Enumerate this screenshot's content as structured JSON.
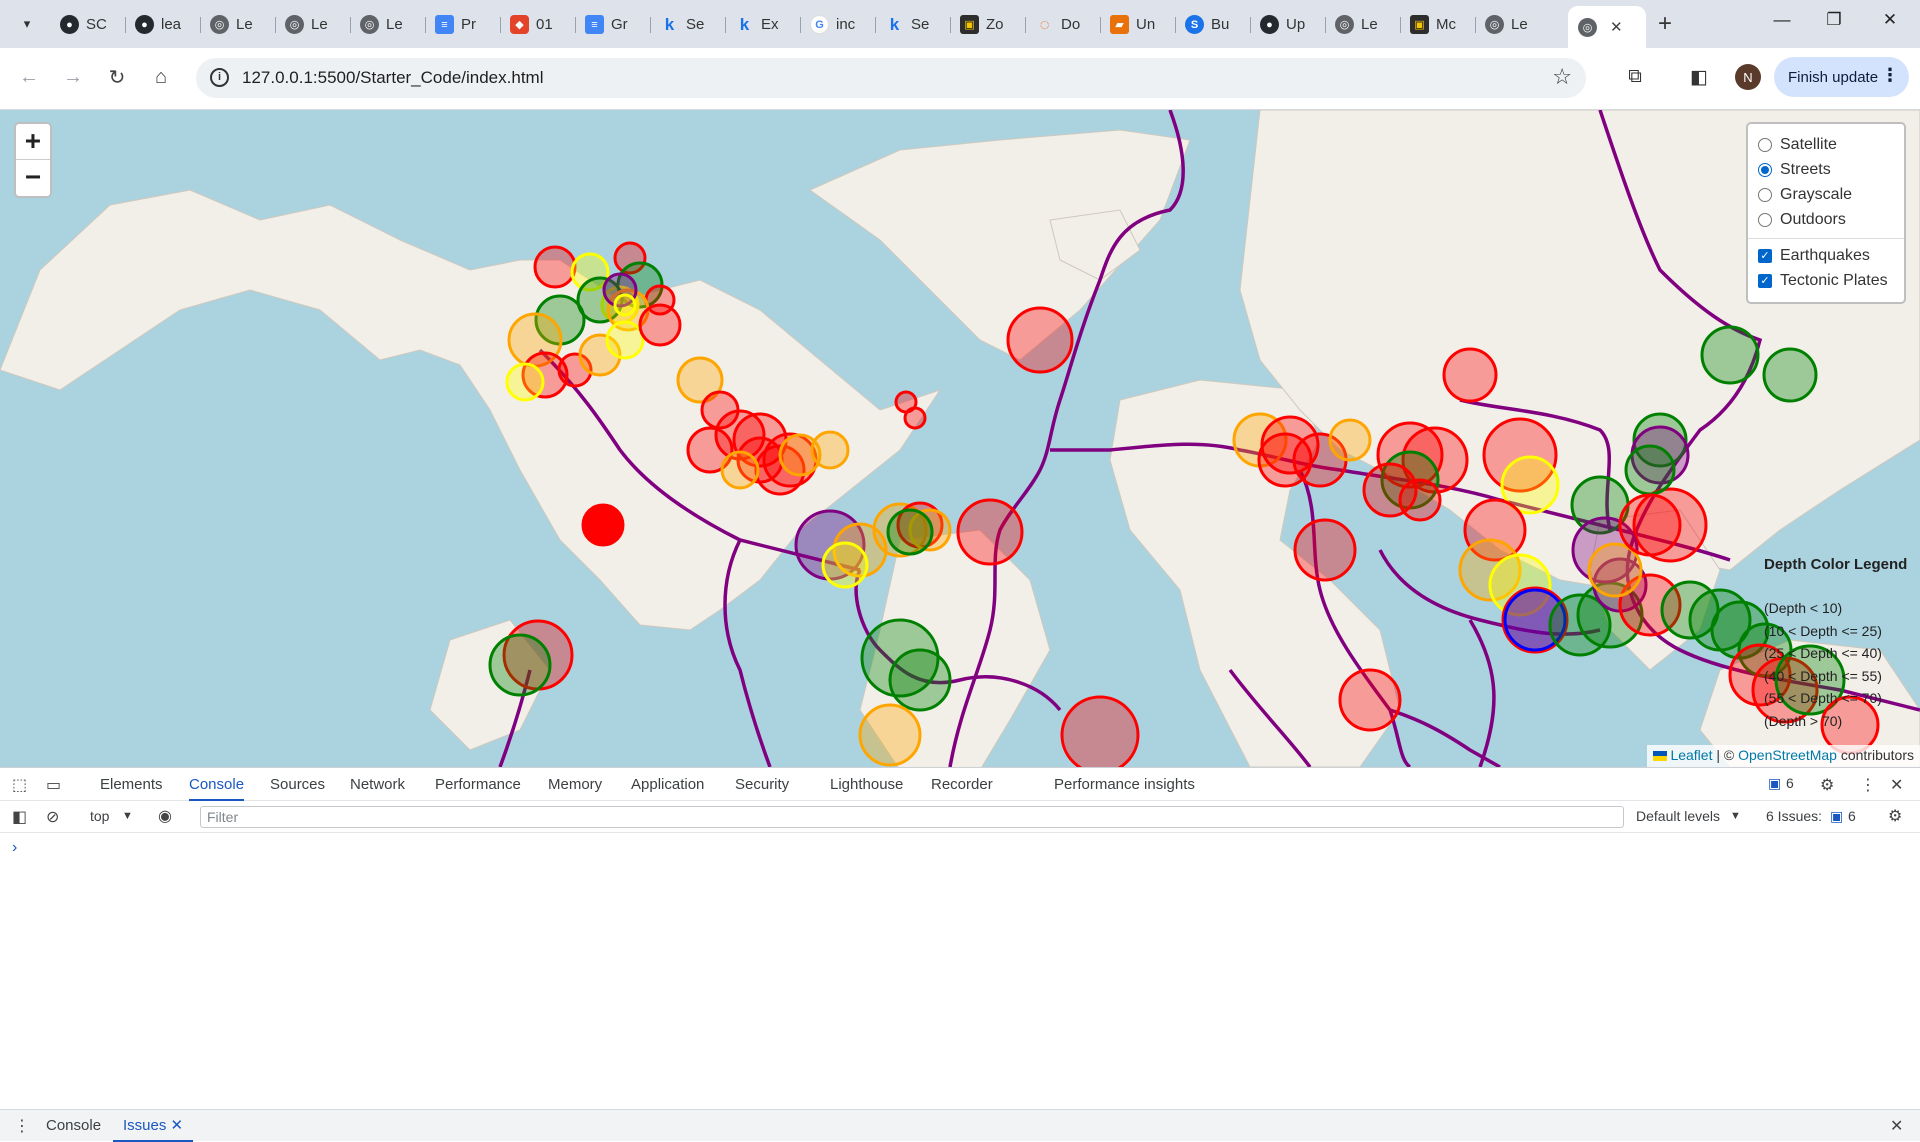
{
  "browser": {
    "tabs": [
      {
        "label": "SC",
        "icon": "github-icon"
      },
      {
        "label": "lea",
        "icon": "github-icon"
      },
      {
        "label": "Le",
        "icon": "globe-icon"
      },
      {
        "label": "Le",
        "icon": "globe-icon"
      },
      {
        "label": "Le",
        "icon": "globe-icon"
      },
      {
        "label": "Pr",
        "icon": "google-docs-icon"
      },
      {
        "label": "01",
        "icon": "gitlab-icon"
      },
      {
        "label": "Gr",
        "icon": "google-docs-icon"
      },
      {
        "label": "Se",
        "icon": "k-icon"
      },
      {
        "label": "Ex",
        "icon": "k-icon"
      },
      {
        "label": "inc",
        "icon": "google-icon"
      },
      {
        "label": "Se",
        "icon": "k-icon"
      },
      {
        "label": "Zo",
        "icon": "zoom-icon"
      },
      {
        "label": "Do",
        "icon": "jupyter-icon"
      },
      {
        "label": "Un",
        "icon": "book-icon"
      },
      {
        "label": "Bu",
        "icon": "skype-icon"
      },
      {
        "label": "Up",
        "icon": "github-icon"
      },
      {
        "label": "Le",
        "icon": "globe-icon"
      },
      {
        "label": "Mc",
        "icon": "zoom-icon"
      },
      {
        "label": "Le",
        "icon": "globe-icon"
      }
    ],
    "active_tab_close": "✕",
    "new_tab": "+",
    "url": "127.0.0.1:5500/Starter_Code/index.html",
    "profile_initial": "N",
    "finish_update": "Finish update"
  },
  "map": {
    "zoom_in": "+",
    "zoom_out": "−",
    "base_layers": [
      "Satellite",
      "Streets",
      "Grayscale",
      "Outdoors"
    ],
    "selected_base_layer": "Streets",
    "overlays": [
      "Earthquakes",
      "Tectonic Plates"
    ],
    "legend": {
      "title": "Depth Color Legend",
      "items": [
        {
          "label": "(Depth < 10)",
          "color": "#00ff00"
        },
        {
          "label": "(10 < Depth <= 25)",
          "color": "#008000"
        },
        {
          "label": "(25 < Depth <= 40)",
          "color": "#ffff00"
        },
        {
          "label": "(40 < Depth <= 55)",
          "color": "#ffa500"
        },
        {
          "label": "(55 < Depth <= 70)",
          "color": "#ff0000"
        },
        {
          "label": "(Depth > 70)",
          "color": "#800080"
        }
      ]
    },
    "attribution": {
      "leaflet": "Leaflet",
      "separator": " | © ",
      "osm": "OpenStreetMap",
      "suffix": " contributors"
    },
    "colors": {
      "ocean": "#aad3df",
      "land": "#f2efe9",
      "plates": "#800080"
    }
  },
  "devtools": {
    "tabs": [
      "Elements",
      "Console",
      "Sources",
      "Network",
      "Performance",
      "Memory",
      "Application",
      "Security",
      "Lighthouse",
      "Recorder",
      "Performance insights"
    ],
    "active_tab": "Console",
    "message_count": "6",
    "context": "top",
    "filter_placeholder": "Filter",
    "levels": "Default levels",
    "issues_label": "6 Issues:",
    "issues_count": "6",
    "prompt": "›",
    "drawer_tabs": [
      "Console",
      "Issues"
    ],
    "drawer_active": "Issues"
  }
}
